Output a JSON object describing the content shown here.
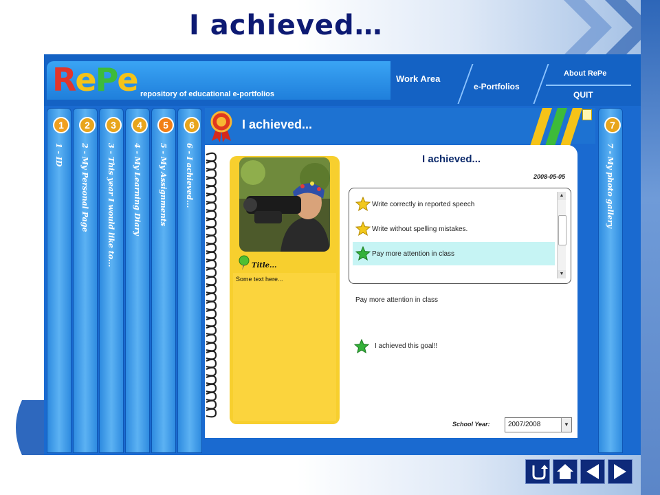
{
  "slide": {
    "title": "I achieved…"
  },
  "app": {
    "logo": {
      "r": "R",
      "e1": "e",
      "p": "P",
      "e2": "e"
    },
    "tagline": "repository of educational e-portfolios",
    "nav": {
      "work_area": "Work Area",
      "eportfolios": "e-Portfolios",
      "about": "About RePe",
      "quit": "QUIT"
    },
    "tabs": [
      {
        "num": "1",
        "label": "1 - ID",
        "color": "#f0a020"
      },
      {
        "num": "2",
        "label": "2 - My Personal Page",
        "color": "#e8a51c"
      },
      {
        "num": "3",
        "label": "3 - This year I would like to...",
        "color": "#e8a51c"
      },
      {
        "num": "4",
        "label": "4 - My Learning Diary",
        "color": "#e8a51c"
      },
      {
        "num": "5",
        "label": "5 - My Assignments",
        "color": "#f17f16"
      },
      {
        "num": "6",
        "label": "6 - I achieved...",
        "color": "#e8a51c"
      },
      {
        "num": "7",
        "label": "7 - My photo gallery",
        "color": "#e8a51c"
      }
    ],
    "content_heading": "I achieved...",
    "card": {
      "title": "Title...",
      "text": "Some text here..."
    },
    "right_title": "I achieved...",
    "date": "2008-05-05",
    "goals": [
      {
        "text": "Write correctly in reported speech",
        "star": "yellow-star-icon",
        "selected": false
      },
      {
        "text": "Write without spelling mistakes.",
        "star": "yellow-star-icon",
        "selected": false
      },
      {
        "text": "Pay more attention in class",
        "star": "green-star-icon",
        "selected": true
      }
    ],
    "detail_text": "Pay more attention in class",
    "achieved_text": "I achieved this goal!!",
    "school_year_label": "School Year:",
    "school_year_value": "2007/2008"
  },
  "colors": {
    "title": "#0d1a73",
    "app_blue": "#1a6ad0",
    "yellow_card": "#f7cf2e",
    "selected_row": "#c6f4f4",
    "star_yellow": "#f2c81c",
    "star_green": "#34b13a"
  },
  "bottom_nav": [
    "return-icon",
    "home-icon",
    "previous-icon",
    "next-icon"
  ]
}
